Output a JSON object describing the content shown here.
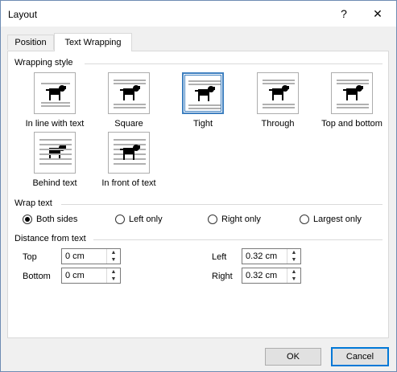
{
  "window": {
    "title": "Layout",
    "help_glyph": "?",
    "close_glyph": "✕"
  },
  "tabs": [
    {
      "label": "Position"
    },
    {
      "label": "Text Wrapping",
      "active": true
    }
  ],
  "wrapping_style": {
    "heading": "Wrapping style",
    "options": [
      {
        "label": "In line with text",
        "selected": false
      },
      {
        "label": "Square",
        "selected": false
      },
      {
        "label": "Tight",
        "selected": true
      },
      {
        "label": "Through",
        "selected": false
      },
      {
        "label": "Top and bottom",
        "selected": false
      },
      {
        "label": "Behind text",
        "selected": false
      },
      {
        "label": "In front of text",
        "selected": false
      }
    ]
  },
  "wrap_text": {
    "heading": "Wrap text",
    "options": [
      {
        "label": "Both sides",
        "checked": true
      },
      {
        "label": "Left only",
        "checked": false
      },
      {
        "label": "Right only",
        "checked": false
      },
      {
        "label": "Largest only",
        "checked": false
      }
    ]
  },
  "distance": {
    "heading": "Distance from text",
    "top_label": "Top",
    "top_value": "0 cm",
    "bottom_label": "Bottom",
    "bottom_value": "0 cm",
    "left_label": "Left",
    "left_value": "0.32 cm",
    "right_label": "Right",
    "right_value": "0.32 cm"
  },
  "buttons": {
    "ok": "OK",
    "cancel": "Cancel"
  },
  "colors": {
    "accent": "#0078d7",
    "selected_border": "#3f80c0"
  }
}
